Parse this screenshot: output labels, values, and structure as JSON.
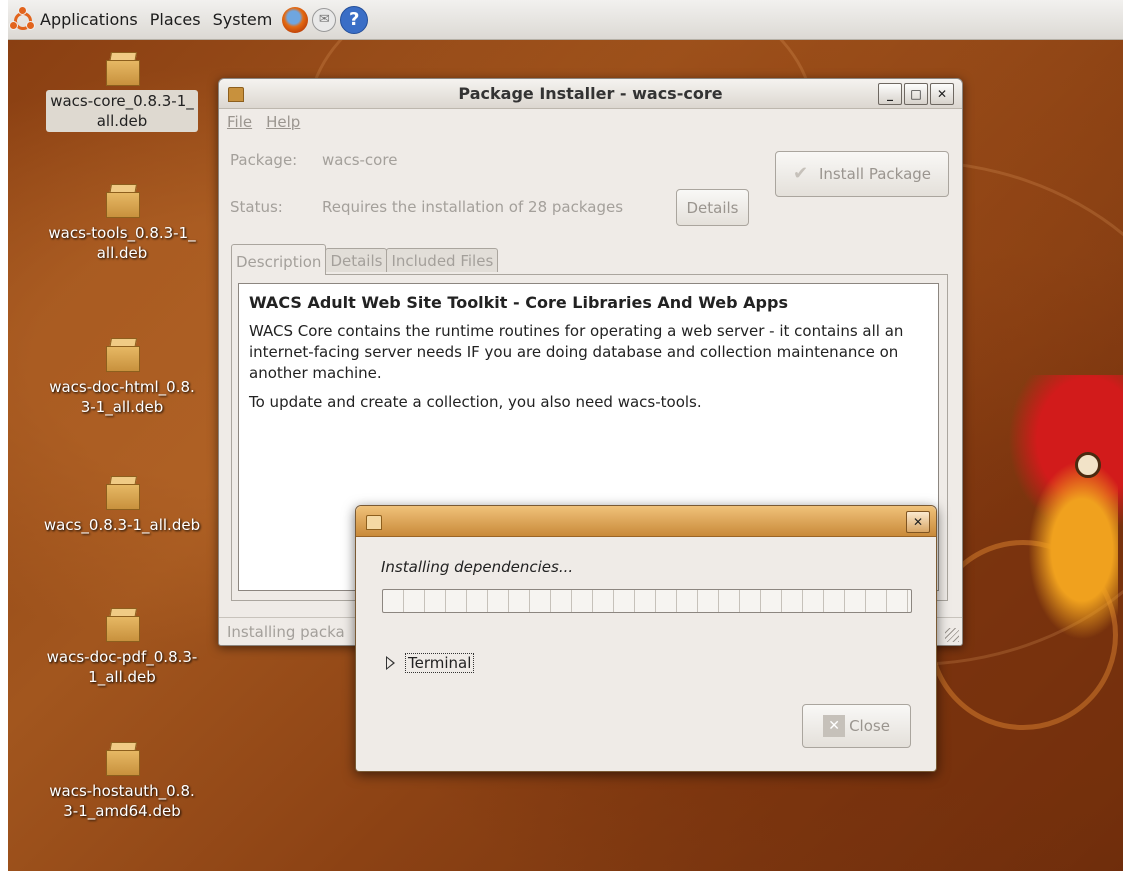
{
  "panel": {
    "menus": [
      "Applications",
      "Places",
      "System"
    ],
    "launchers": [
      "firefox-icon",
      "mail-icon",
      "help-icon"
    ]
  },
  "desktop": {
    "icons": [
      {
        "label": "wacs-core_0.8.3-1_all.deb",
        "line1": "wacs-core_0.8.3-1_",
        "line2": "all.deb",
        "selected": true
      },
      {
        "label": "wacs-tools_0.8.3-1_all.deb",
        "line1": "wacs-tools_0.8.3-1_",
        "line2": "all.deb",
        "selected": false
      },
      {
        "label": "wacs-doc-html_0.8.3-1_all.deb",
        "line1": "wacs-doc-html_0.8.",
        "line2": "3-1_all.deb",
        "selected": false
      },
      {
        "label": "wacs_0.8.3-1_all.deb",
        "line1": "wacs_0.8.3-1_all.deb",
        "line2": "",
        "selected": false
      },
      {
        "label": "wacs-doc-pdf_0.8.3-1_all.deb",
        "line1": "wacs-doc-pdf_0.8.3-",
        "line2": "1_all.deb",
        "selected": false
      },
      {
        "label": "wacs-hostauth_0.8.3-1_amd64.deb",
        "line1": "wacs-hostauth_0.8.",
        "line2": "3-1_amd64.deb",
        "selected": false
      }
    ]
  },
  "installer": {
    "title": "Package Installer - wacs-core",
    "menus": [
      "File",
      "Help"
    ],
    "package_label": "Package:",
    "package_value": "wacs-core",
    "status_label": "Status:",
    "status_value": "Requires the installation of 28 packages",
    "details_button": "Details",
    "install_button": "Install Package",
    "tabs": [
      "Description",
      "Details",
      "Included Files"
    ],
    "active_tab": "Description",
    "description": {
      "heading": "WACS Adult Web Site Toolkit - Core Libraries And Web Apps",
      "para1": "WACS Core contains the runtime routines for operating a web server - it contains all an internet-facing server needs IF you are doing database and collection maintenance on another machine.",
      "para2": "To update and create a collection, you also need wacs-tools."
    },
    "statusbar": "Installing packa"
  },
  "dialog": {
    "message": "Installing dependencies...",
    "progress": 0,
    "expander_label": "Terminal",
    "close_button": "Close"
  },
  "colors": {
    "desktop": "#8a3f12",
    "dialog_titlebar": "#e0a554",
    "ubuntu_logo": "#e2641d"
  }
}
